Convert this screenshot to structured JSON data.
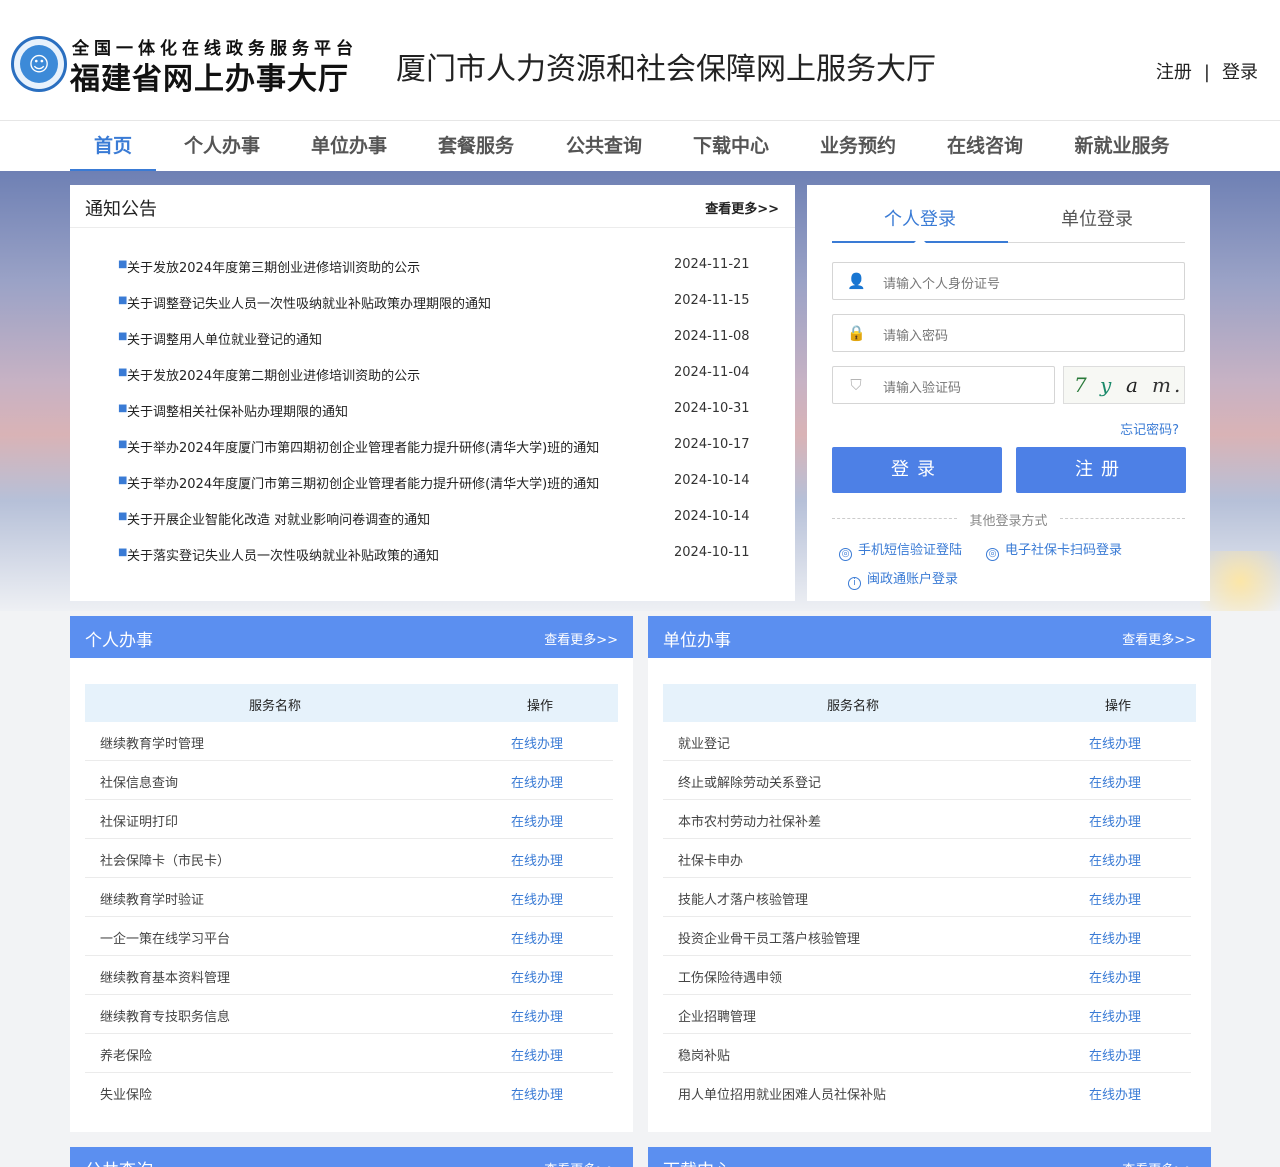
{
  "header": {
    "logo_line1": "全国一体化在线政务服务平台",
    "logo_line2": "福建省网上办事大厅",
    "site_title": "厦门市人力资源和社会保障网上服务大厅",
    "register": "注册",
    "separator": "|",
    "login": "登录"
  },
  "nav": {
    "items": [
      "首页",
      "个人办事",
      "单位办事",
      "套餐服务",
      "公共查询",
      "下载中心",
      "业务预约",
      "在线咨询",
      "新就业服务"
    ],
    "active": "首页"
  },
  "notice": {
    "title": "通知公告",
    "more": "查看更多>>",
    "items": [
      {
        "text": "关于发放2024年度第三期创业进修培训资助的公示",
        "date": "2024-11-21"
      },
      {
        "text": "关于调整登记失业人员一次性吸纳就业补贴政策办理期限的通知",
        "date": "2024-11-15"
      },
      {
        "text": "关于调整用人单位就业登记的通知",
        "date": "2024-11-08"
      },
      {
        "text": "关于发放2024年度第二期创业进修培训资助的公示",
        "date": "2024-11-04"
      },
      {
        "text": "关于调整相关社保补贴办理期限的通知",
        "date": "2024-10-31"
      },
      {
        "text": "关于举办2024年度厦门市第四期初创企业管理者能力提升研修(清华大学)班的通知",
        "date": "2024-10-17"
      },
      {
        "text": "关于举办2024年度厦门市第三期初创企业管理者能力提升研修(清华大学)班的通知",
        "date": "2024-10-14"
      },
      {
        "text": "关于开展企业智能化改造 对就业影响问卷调查的通知",
        "date": "2024-10-14"
      },
      {
        "text": "关于落实登记失业人员一次性吸纳就业补贴政策的通知",
        "date": "2024-10-11"
      }
    ]
  },
  "login": {
    "tab_personal": "个人登录",
    "tab_unit": "单位登录",
    "id_placeholder": "请输入个人身份证号",
    "pwd_placeholder": "请输入密码",
    "captcha_placeholder": "请输入验证码",
    "captcha_chars": [
      "7",
      "y",
      "a",
      "m",
      "."
    ],
    "forgot": "忘记密码?",
    "login_btn": "登录",
    "register_btn": "注册",
    "other_title": "其他登录方式",
    "other_sms": "手机短信验证登陆",
    "other_card": "电子社保卡扫码登录",
    "other_mzt": "闽政通账户登录"
  },
  "personal_services": {
    "title": "个人办事",
    "more": "查看更多>>",
    "col_name": "服务名称",
    "col_op": "操作",
    "rows": [
      {
        "name": "继续教育学时管理",
        "op": "在线办理"
      },
      {
        "name": "社保信息查询",
        "op": "在线办理"
      },
      {
        "name": "社保证明打印",
        "op": "在线办理"
      },
      {
        "name": "社会保障卡（市民卡）",
        "op": "在线办理"
      },
      {
        "name": "继续教育学时验证",
        "op": "在线办理"
      },
      {
        "name": "一企一策在线学习平台",
        "op": "在线办理"
      },
      {
        "name": "继续教育基本资料管理",
        "op": "在线办理"
      },
      {
        "name": "继续教育专技职务信息",
        "op": "在线办理"
      },
      {
        "name": "养老保险",
        "op": "在线办理"
      },
      {
        "name": "失业保险",
        "op": "在线办理"
      }
    ]
  },
  "unit_services": {
    "title": "单位办事",
    "more": "查看更多>>",
    "col_name": "服务名称",
    "col_op": "操作",
    "rows": [
      {
        "name": "就业登记",
        "op": "在线办理"
      },
      {
        "name": "终止或解除劳动关系登记",
        "op": "在线办理"
      },
      {
        "name": "本市农村劳动力社保补差",
        "op": "在线办理"
      },
      {
        "name": "社保卡申办",
        "op": "在线办理"
      },
      {
        "name": "技能人才落户核验管理",
        "op": "在线办理"
      },
      {
        "name": "投资企业骨干员工落户核验管理",
        "op": "在线办理"
      },
      {
        "name": "工伤保险待遇申领",
        "op": "在线办理"
      },
      {
        "name": "企业招聘管理",
        "op": "在线办理"
      },
      {
        "name": "稳岗补贴",
        "op": "在线办理"
      },
      {
        "name": "用人单位招用就业困难人员社保补贴",
        "op": "在线办理"
      }
    ]
  },
  "bottom_panels": {
    "public_query": "公共查询",
    "download_center": "下载中心",
    "more": "查看更多>>"
  },
  "colors": {
    "accent": "#3a7bd5",
    "panel_header": "#5b8ff0",
    "button": "#4d80e6"
  }
}
